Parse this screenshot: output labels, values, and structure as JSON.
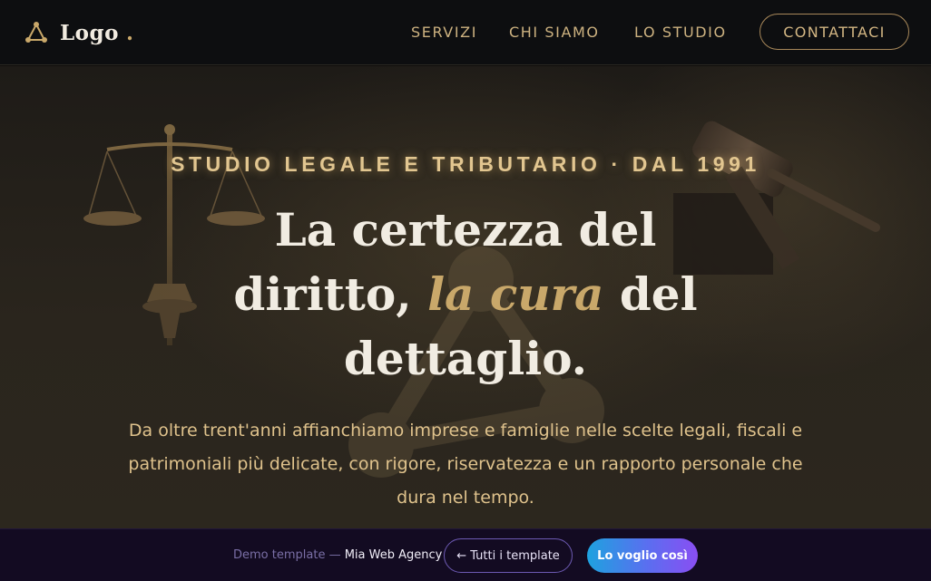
{
  "header": {
    "logo_text": "Logo",
    "logo_dot": ".",
    "nav": {
      "servizi": "SERVIZI",
      "chi_siamo": "CHI SIAMO",
      "lo_studio": "LO STUDIO"
    },
    "cta_label": "CONTATTACI"
  },
  "hero": {
    "kicker": "STUDIO LEGALE E TRIBUTARIO · DAL 1991",
    "headline": {
      "line1": "La certezza del",
      "line2_before": "diritto, ",
      "line2_accent": "la cura",
      "line2_after": " del",
      "line3": "dettaglio."
    },
    "lead": "Da oltre trent'anni affianchiamo imprese e famiglie nelle scelte legali, fiscali e patrimoniali più delicate, con rigore, riservatezza e un rapporto personale che dura nel tempo."
  },
  "demobar": {
    "prefix": "Demo template — ",
    "agency": "Mia Web Agency",
    "templates_button": "← Tutti i template",
    "want_button": "Lo voglio così"
  },
  "colors": {
    "accent_gold": "#c9a86a",
    "header_bg": "#0d0e10",
    "demobar_bg": "#130b22"
  }
}
